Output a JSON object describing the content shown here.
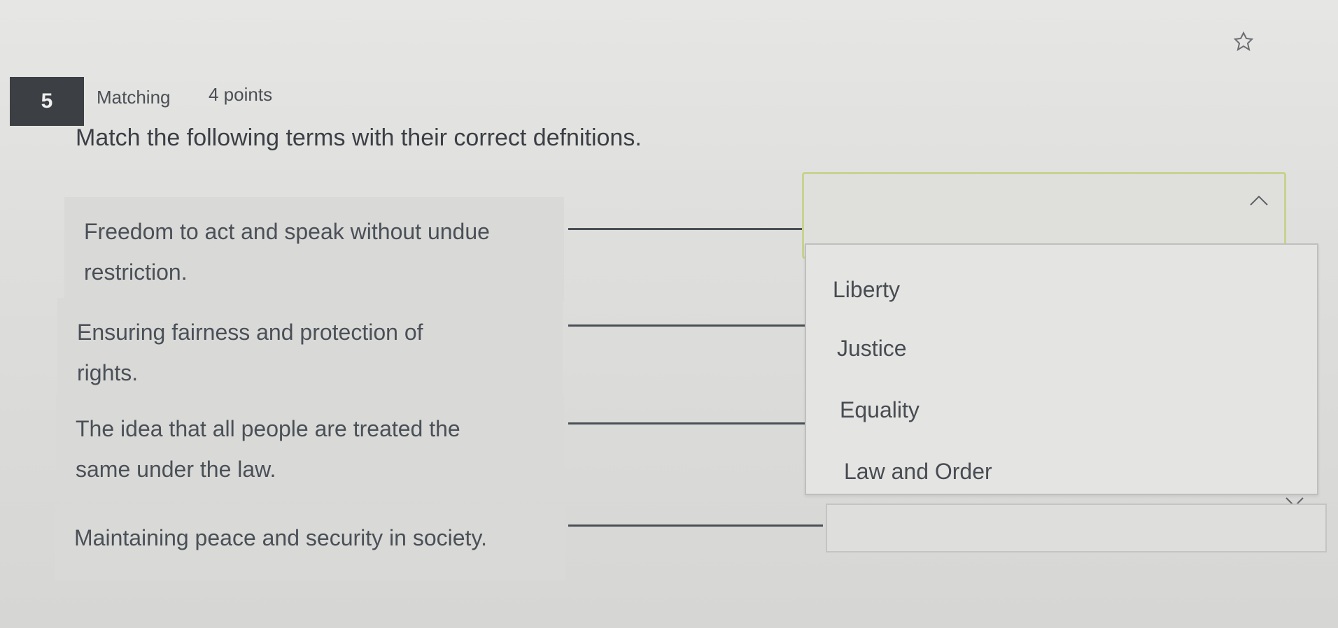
{
  "question": {
    "number": "5",
    "type": "Matching",
    "points": "4 points",
    "instructions": "Match the following terms with their correct defnitions."
  },
  "prompts": [
    {
      "line1": "Freedom to act and speak without undue",
      "line2": "restriction."
    },
    {
      "line1": "Ensuring fairness and protection of",
      "line2": "rights."
    },
    {
      "line1": "The idea that all people are treated the",
      "line2": "same under the law."
    },
    {
      "line1": "Maintaining peace and security in society.",
      "line2": ""
    }
  ],
  "dropdown": {
    "selected": "",
    "options": [
      "Liberty",
      "Justice",
      "Equality",
      "Law and Order"
    ]
  },
  "icons": {
    "pin": "pin-icon",
    "dropdown_toggle": "chevron-up-icon",
    "scroll_down": "chevron-down-icon"
  },
  "colors": {
    "question_badge": "#3c4044",
    "dropdown_focus_border": "#c8d290"
  }
}
